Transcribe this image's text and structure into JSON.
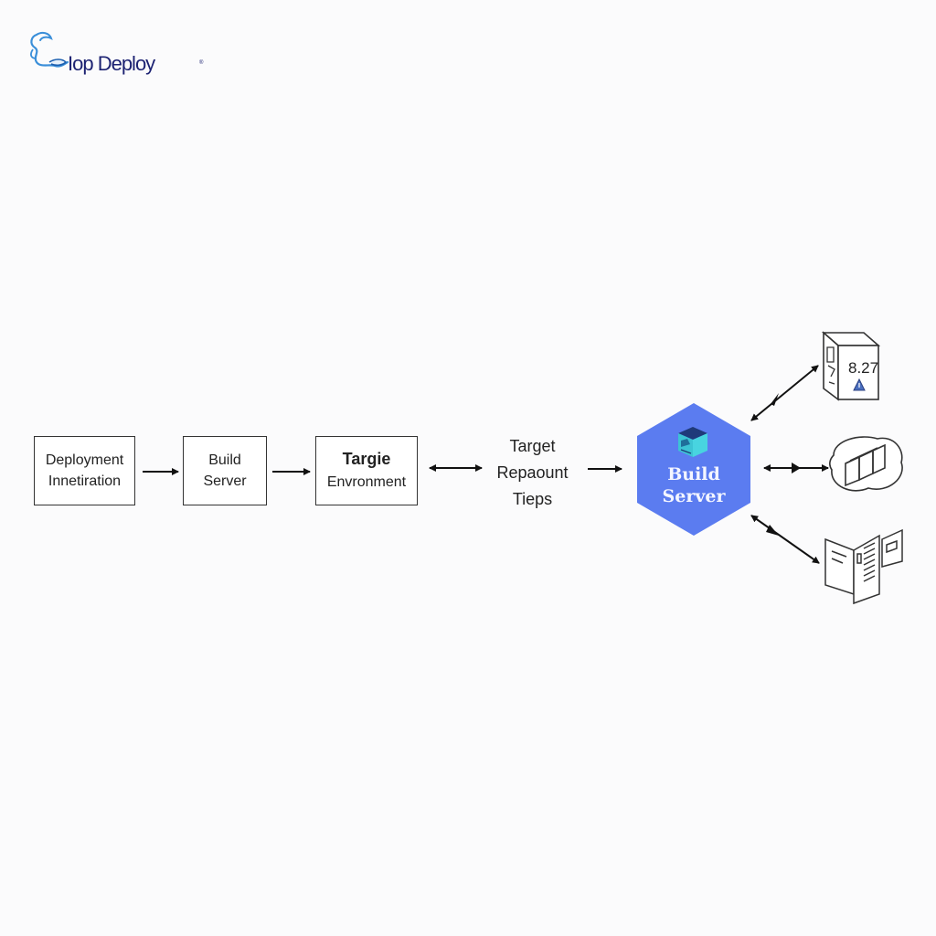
{
  "brand": {
    "name": "Top Deploy",
    "display_text": "Iop Deploy",
    "trademark": "®",
    "logo_icon": "dragon-swirl-icon",
    "color": "#1c2272",
    "icon_color": "#3b8fd9"
  },
  "diagram": {
    "flow": [
      {
        "id": "deployment-innetiration",
        "lines": [
          "Deployment",
          "Innetiration"
        ],
        "shape": "rectangle"
      },
      {
        "id": "build-server-box",
        "lines": [
          "Build",
          "Server"
        ],
        "shape": "rectangle"
      },
      {
        "id": "targie-environment",
        "title": "Targie",
        "subtitle": "Envronment",
        "shape": "rectangle"
      },
      {
        "id": "target-repaount-tieps",
        "lines": [
          "Target",
          "Repaount",
          "Tieps"
        ],
        "shape": "text"
      },
      {
        "id": "build-server-hub",
        "lines": [
          "Build",
          "Server"
        ],
        "shape": "hexagon",
        "icon": "server-cube-icon"
      }
    ],
    "connectors": [
      {
        "from": "deployment-innetiration",
        "to": "build-server-box",
        "type": "arrow"
      },
      {
        "from": "build-server-box",
        "to": "targie-environment",
        "type": "arrow"
      },
      {
        "from": "targie-environment",
        "to": "target-repaount-tieps",
        "type": "double-arrow"
      },
      {
        "from": "target-repaount-tieps",
        "to": "build-server-hub",
        "type": "arrow"
      },
      {
        "from": "build-server-hub",
        "to": "server-box-node",
        "type": "double-arrow"
      },
      {
        "from": "build-server-hub",
        "to": "container-cloud-node",
        "type": "double-arrow"
      },
      {
        "from": "build-server-hub",
        "to": "documents-node",
        "type": "double-arrow"
      }
    ],
    "outputs": [
      {
        "id": "server-box-node",
        "icon": "server-box-icon",
        "label": "8.27",
        "badge": "warning-icon"
      },
      {
        "id": "container-cloud-node",
        "icon": "container-cloud-icon"
      },
      {
        "id": "documents-node",
        "icon": "documents-icon"
      }
    ],
    "colors": {
      "hexagon_fill": "#5b7cf0",
      "hexagon_text": "#f4f6ff",
      "icon_teal": "#3cc4d4",
      "stroke": "#222222",
      "warning": "#4a6fbf"
    }
  }
}
